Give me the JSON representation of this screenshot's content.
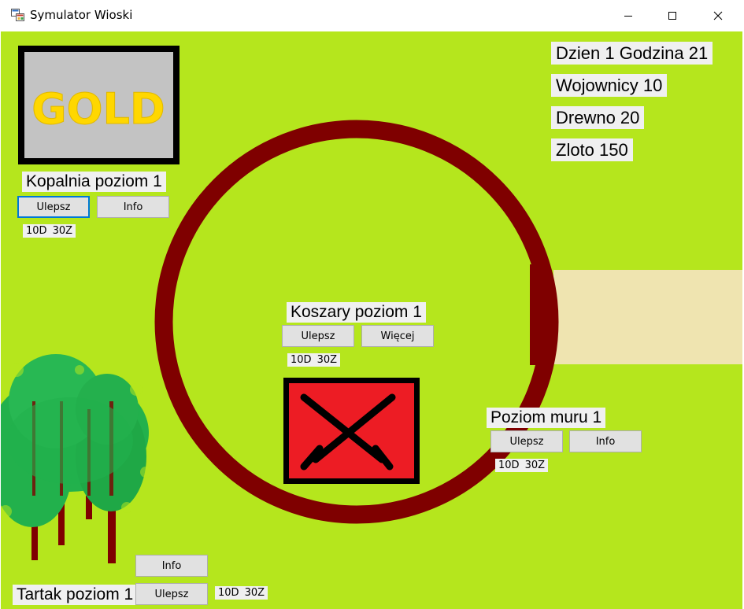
{
  "window": {
    "title": "Symulator Wioski"
  },
  "colors": {
    "grass": "#b5e61d",
    "wall": "#7f0000",
    "road": "#efe4b0",
    "gold": "#ffd700",
    "barracks": "#ed1c24",
    "leaves": "#22b14c"
  },
  "stats": {
    "time": "Dzien 1 Godzina 21",
    "warriors": "Wojownicy 10",
    "wood": "Drewno 20",
    "gold": "Zloto 150"
  },
  "mine": {
    "sign": "GOLD",
    "label": "Kopalnia poziom 1",
    "upgrade_label": "Ulepsz",
    "info_label": "Info",
    "cost_wood": "10D",
    "cost_gold": "30Z"
  },
  "barracks": {
    "label": "Koszary poziom 1",
    "upgrade_label": "Ulepsz",
    "more_label": "Więcej",
    "cost_wood": "10D",
    "cost_gold": "30Z",
    "icon": "crossed-swords-icon"
  },
  "wall": {
    "label": "Poziom muru 1",
    "upgrade_label": "Ulepsz",
    "info_label": "Info",
    "cost_wood": "10D",
    "cost_gold": "30Z"
  },
  "sawmill": {
    "label": "Tartak poziom 1",
    "info_label": "Info",
    "upgrade_label": "Ulepsz",
    "cost_wood": "10D",
    "cost_gold": "30Z"
  }
}
